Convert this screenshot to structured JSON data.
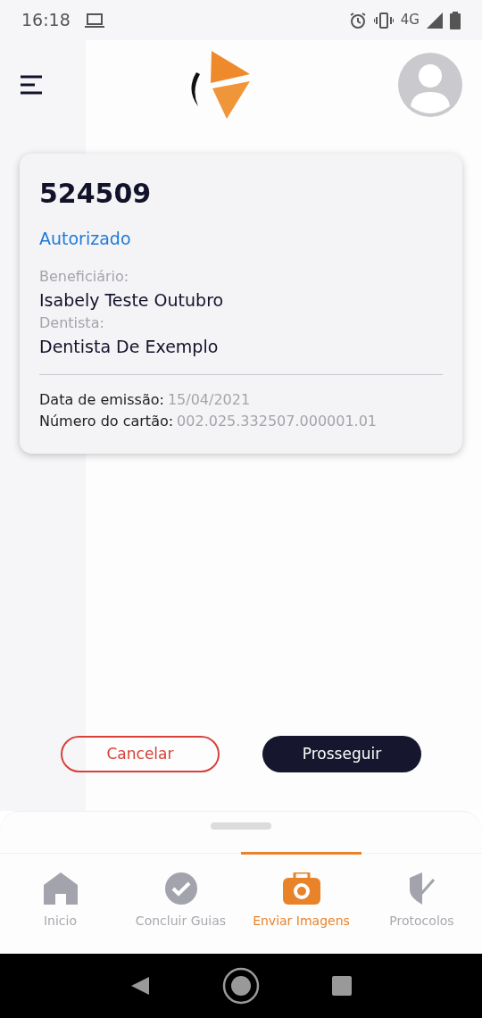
{
  "status_bar": {
    "time": "16:18",
    "network": "4G"
  },
  "card": {
    "number": "524509",
    "status": "Autorizado",
    "fields": [
      {
        "label": "Beneficiário:",
        "value": "Isabely Teste Outubro"
      },
      {
        "label": "Dentista:",
        "value": "Dentista De Exemplo"
      }
    ],
    "details": [
      {
        "label": "Data de emissão:",
        "value": "15/04/2021"
      },
      {
        "label": "Número do cartão:",
        "value": "002.025.332507.000001.01"
      }
    ]
  },
  "buttons": [
    {
      "label": "Cancelar",
      "kind": "outline"
    },
    {
      "label": "Prosseguir",
      "kind": "solid"
    }
  ],
  "tabs": [
    {
      "label": "Inicio",
      "kind": "home",
      "selected": false
    },
    {
      "label": "Concluir Guias",
      "kind": "check",
      "selected": false
    },
    {
      "label": "Enviar Imagens",
      "kind": "camera",
      "selected": true
    },
    {
      "label": "Protocolos",
      "kind": "shield",
      "selected": false
    }
  ]
}
